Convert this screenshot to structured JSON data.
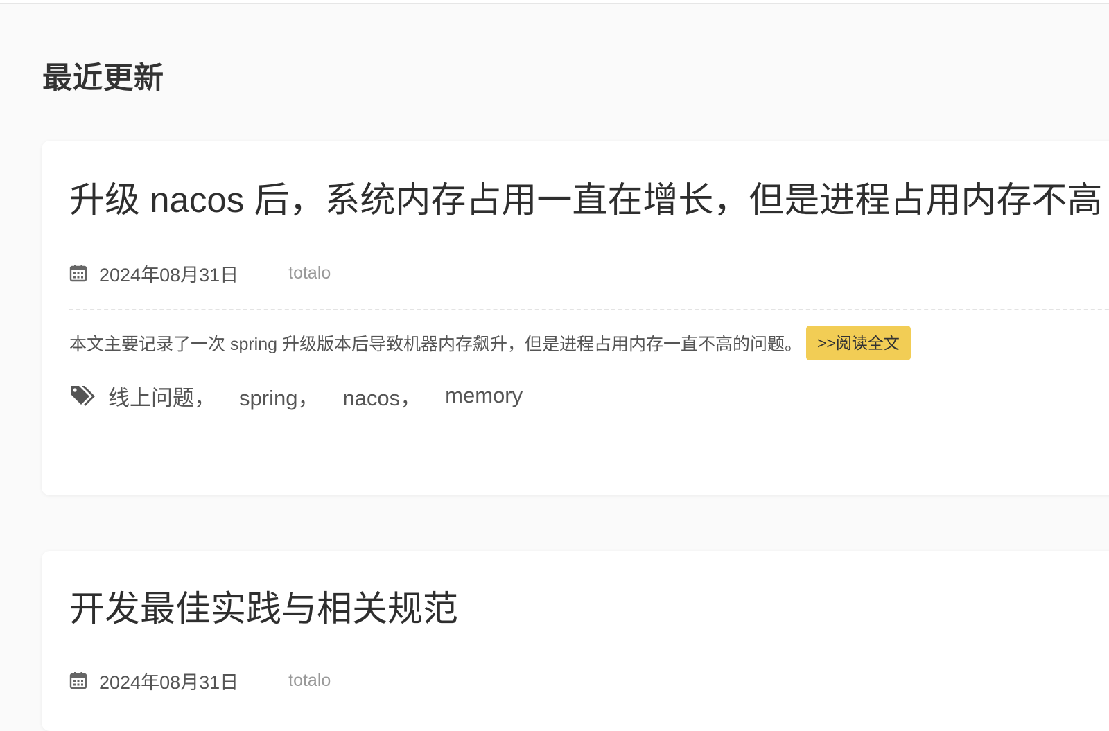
{
  "section": {
    "title": "最近更新"
  },
  "posts": [
    {
      "title": "升级 nacos 后，系统内存占用一直在增长，但是进程占用内存不高",
      "date": "2024年08月31日",
      "author": "totalo",
      "summary": "本文主要记录了一次 spring 升级版本后导致机器内存飙升，但是进程占用内存一直不高的问题。",
      "read_more": ">>阅读全文",
      "tags": [
        "线上问题，",
        "spring，",
        "nacos，",
        "memory"
      ]
    },
    {
      "title": "开发最佳实践与相关规范",
      "date": "2024年08月31日",
      "author": "totalo"
    }
  ],
  "colors": {
    "accent": "#f2cd55",
    "background": "#fafafa",
    "card": "#ffffff"
  },
  "icons": {
    "date": "calendar-icon",
    "tags": "tags-icon"
  }
}
